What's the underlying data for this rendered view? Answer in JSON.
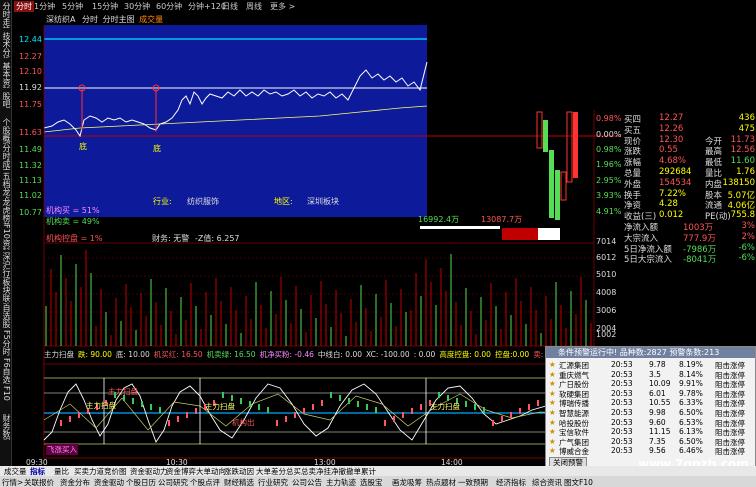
{
  "left_sidebar": [
    "分时走势",
    "技术分析",
    "基本资料",
    "股吧",
    "个股概况",
    "分时成交",
    "五档龙虎",
    "龙虎榜单",
    "F10资料",
    "深沪行情",
    "板块联动",
    "自选股",
    "F5分时",
    "F6自选",
    "F10",
    "财务数据"
  ],
  "topbar": {
    "active": "分时",
    "periods": [
      "1分钟",
      "5分钟",
      "15分钟",
      "30分钟",
      "60分钟",
      "分钟+120",
      "日线",
      "周线",
      "更多 >"
    ]
  },
  "price_chart": {
    "title_name": "深纺织A",
    "title_mode": "分时",
    "title_sub": "分时主图",
    "title_vol": "成交量",
    "y_labels": [
      "12.44",
      "12.27",
      "12.10",
      "11.92",
      "11.75",
      "11.63",
      "11.49",
      "11.32",
      "11.13",
      "11.02",
      "10.77"
    ],
    "annotations": {
      "di1": "底",
      "di2": "底"
    },
    "info_industry_label": "行业:",
    "info_industry": "纺织服饰",
    "info_region_label": "地区:",
    "info_region": "深圳板块",
    "jgm_buy": "机构买 = 51%",
    "jgm_sell": "机构卖 = 49%",
    "jgm_control": "机构控盘 = 1%",
    "amount_in": "16992.4万",
    "amount_out": "13087.7万",
    "finance": "财务: 无警",
    "z_value": "-Z值: 6.257"
  },
  "pct_labels": [
    "0.98%",
    "0.00%",
    "0.98%",
    "1.96%",
    "2.95%",
    "3.93%",
    "4.91%"
  ],
  "volume_labels": [
    "7014",
    "6012",
    "5010",
    "4008",
    "3006",
    "2004",
    "1002"
  ],
  "quote": {
    "rows": [
      {
        "l": "买四",
        "v": "12.27",
        "c": "#ff5555",
        "r": "436"
      },
      {
        "l": "买五",
        "v": "12.26",
        "c": "#ff5555",
        "r": "475"
      },
      {
        "l": "现价",
        "v": "12.30",
        "c": "#ff5555",
        "r2l": "今开",
        "r2": "11.73"
      },
      {
        "l": "涨跌",
        "v": "0.55",
        "c": "#ff5555",
        "r2l": "最高",
        "r2": "12.56"
      },
      {
        "l": "涨幅",
        "v": "4.68%",
        "c": "#ff5555",
        "r2l": "最低",
        "r2": "11.60"
      },
      {
        "l": "总量",
        "v": "292684",
        "c": "#ffff00",
        "r2l": "量比",
        "r2": "1.76"
      },
      {
        "l": "外盘",
        "v": "154534",
        "c": "#ff5555",
        "r2l": "内盘",
        "r2": "138150"
      },
      {
        "l": "换手",
        "v": "7.22%",
        "c": "#ffff00",
        "r2l": "股本",
        "r2": "5.07亿"
      },
      {
        "l": "净资",
        "v": "4.28",
        "c": "#ffff00",
        "r2l": "流通",
        "r2": "4.06亿"
      },
      {
        "l": "收益(三)",
        "v": "0.012",
        "c": "#ffff00",
        "r2l": "PE(动)",
        "r2": "755.8"
      },
      {
        "l": "净流入额",
        "v": "1003万",
        "c": "#ff5555",
        "r": "3%"
      },
      {
        "l": "大宗流入",
        "v": "777.9万",
        "c": "#ff5555",
        "r": "2%"
      },
      {
        "l": "5日净流入额",
        "v": "-7986万",
        "c": "#55dd55",
        "r": "-6%"
      },
      {
        "l": "5日大宗流入",
        "v": "-8041万",
        "c": "#55dd55",
        "r": "-6%"
      }
    ]
  },
  "indicator": {
    "header": [
      {
        "t": "主力扫盘",
        "c": "#ddd"
      },
      {
        "t": "跌: 90.00",
        "c": "#ffff00"
      },
      {
        "t": "底: 10.00",
        "c": "#ddd"
      },
      {
        "t": "机买红: 16.50",
        "c": "#ff5555"
      },
      {
        "t": "机卖绿: 16.50",
        "c": "#55dd55"
      },
      {
        "t": "机净买粉: -0.46",
        "c": "#ff88ff"
      },
      {
        "t": "中线白: 0.00",
        "c": "#ddd"
      },
      {
        "t": "XC: -100.00",
        "c": "#ddd"
      },
      {
        "t": ": 0.00",
        "c": "#ddd"
      },
      {
        "t": "高度控盘: 0.00",
        "c": "#ffff00"
      },
      {
        "t": "控盘:0.00",
        "c": "#ffff00"
      },
      {
        "t": "卖: 0.00",
        "c": "#ff5555"
      },
      {
        "t": "神: 0.29",
        "c": "#55dd55"
      },
      {
        "t": "DO: 0.71",
        "c": "#ff5555"
      }
    ],
    "labels": {
      "zhuli1": "主力扫盘",
      "zhuli2": "主力扫盘",
      "zhuli3": "主力扫盘",
      "zhuli4": "主力扫盘",
      "jgcl": "机构出",
      "buy_in": "飞涨买入"
    },
    "time_labels": [
      "09:30",
      "10:30",
      "13:00",
      "14:00"
    ]
  },
  "alert": {
    "title": "条件预警运行中! 品种数:2827 预警条数:213",
    "rows": [
      [
        "汇源集团",
        "20:53",
        "9.78",
        "8.19%",
        "阻击涨停"
      ],
      [
        "重庆燃气",
        "20:53",
        "3.5",
        "8.14%",
        "阻击涨停"
      ],
      [
        "广日股份",
        "20:53",
        "10.09",
        "9.91%",
        "阻击涨停"
      ],
      [
        "软硬集团",
        "20:53",
        "6.01",
        "9.78%",
        "阻击涨停"
      ],
      [
        "博瑞传播",
        "20:53",
        "10.55",
        "6.33%",
        "阻击涨停"
      ],
      [
        "智慧能源",
        "20:53",
        "9.98",
        "6.50%",
        "阻击涨停"
      ],
      [
        "哈投股份",
        "20:53",
        "9.60",
        "6.53%",
        "阻击涨停"
      ],
      [
        "宝信软件",
        "20:53",
        "11.15",
        "6.13%",
        "阻击涨停"
      ],
      [
        "广气集团",
        "20:53",
        "7.35",
        "6.50%",
        "阻击涨停"
      ],
      [
        "博威合金",
        "20:53",
        "9.56",
        "6.46%",
        "阻击涨停"
      ]
    ],
    "close": "关闭预警"
  },
  "tabs_row1": [
    "成交量",
    "指标",
    "量比",
    "买卖力道",
    "竞价图",
    "资金驱动力",
    "资金博弈",
    "大单动向",
    "涨跌动因",
    "大单差分",
    "总买总卖",
    "净挂净撤",
    "撤单累计"
  ],
  "tabs_row2": [
    "行情>",
    "关联报价",
    "资金分布",
    "资金驱动",
    "个股日历",
    "公司研究",
    "个股点评",
    "财经精选",
    "行业研究",
    "公司公告",
    "主力轨迹",
    "选股宝",
    "画龙吸筹",
    "热点题材",
    "一致预期",
    "经济指标",
    "综合资讯",
    "图文F10"
  ],
  "watermark": "www.7gpzb.com"
}
